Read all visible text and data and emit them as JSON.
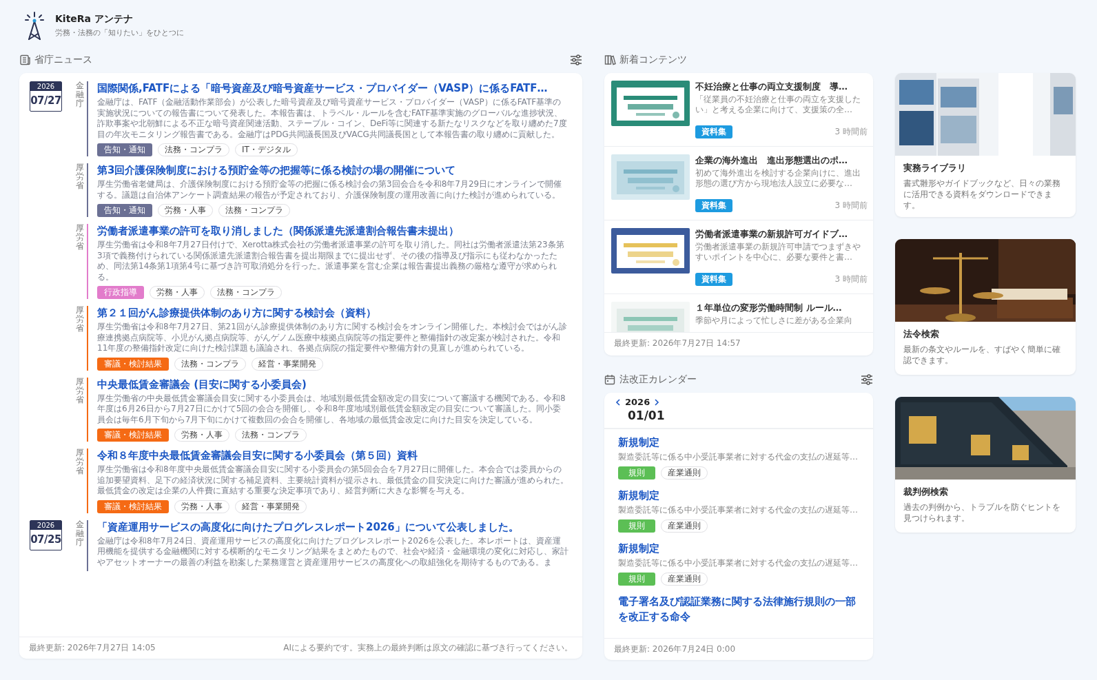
{
  "app": {
    "name": "KiteRa アンテナ",
    "tagline": "労務・法務の「知りたい」をひとつに"
  },
  "news": {
    "title": "省庁ニュース",
    "items": [
      {
        "date": {
          "year": "2026",
          "day": "07/27"
        },
        "ministry": "金融庁",
        "title": "国際関係,FATFによる「暗号資産及び暗号資産サービス・プロバイダー（VASP）に係るFATF…",
        "summary": "金融庁は、FATF（金融活動作業部会）が公表した暗号資産及び暗号資産サービス・プロバイダー（VASP）に係るFATF基準の実施状況についての報告書について発表した。本報告書は、トラベル・ルールを含むFATF基準実施のグローバルな進捗状況、詐欺事案や北朝鮮による不正な暗号資産関連活動、ステーブル・コイン、DeFi等に関連する新たなリスクなどを取り纏めた7度目の年次モニタリング報告書である。金融庁はPDG共同議長国及びVACG共同議長国として本報告書の取り纏めに貢献した。",
        "category": {
          "label": "告知・通知",
          "color": "#6b7094"
        },
        "tags": [
          "法務・コンプラ",
          "IT・デジタル"
        ]
      },
      {
        "ministry": "厚労省",
        "title": "第3回介護保険制度における預貯金等の把握等に係る検討の場の開催について",
        "summary": "厚生労働省老健局は、介護保険制度における預貯金等の把握に係る検討会の第3回会合を令和8年7月29日にオンラインで開催する。議題は自治体アンケート調査結果の報告が予定されており、介護保険制度の運用改善に向けた検討が進められている。",
        "category": {
          "label": "告知・通知",
          "color": "#6b7094"
        },
        "tags": [
          "労務・人事",
          "法務・コンプラ"
        ]
      },
      {
        "ministry": "厚労省",
        "title": "労働者派遣事業の許可を取り消しました（関係派遣先派遣割合報告書未提出）",
        "summary": "厚生労働省は令和8年7月27日付けで、Xerotta株式会社の労働者派遣事業の許可を取り消した。同社は労働者派遣法第23条第3項で義務付けられている関係派遣先派遣割合報告書を提出期限までに提出せず、その後の指導及び指示にも従わなかったため、同法第14条第1項第4号に基づき許可取消処分を行った。派遣事業を営む企業は報告書提出義務の厳格な遵守が求められる。",
        "category": {
          "label": "行政指導",
          "color": "#e27ccb"
        },
        "tags": [
          "労務・人事",
          "法務・コンプラ"
        ]
      },
      {
        "ministry": "厚労省",
        "title": "第２１回がん診療提供体制のあり方に関する検討会（資料）",
        "summary": "厚生労働省は令和8年7月27日、第21回がん診療提供体制のあり方に関する検討会をオンライン開催した。本検討会ではがん診療連携拠点病院等、小児がん拠点病院等、がんゲノム医療中核拠点病院等の指定要件と整備指針の改定案が検討された。令和11年度の整備指針改定に向けた検討課題も議論され、各拠点病院の指定要件や整備方針の見直しが進められている。",
        "category": {
          "label": "審議・検討結果",
          "color": "#f56a14"
        },
        "tags": [
          "法務・コンプラ",
          "経営・事業開発"
        ]
      },
      {
        "ministry": "厚労省",
        "title": "中央最低賃金審議会 (目安に関する小委員会)",
        "summary": "厚生労働省の中央最低賃金審議会目安に関する小委員会は、地域別最低賃金額改定の目安について審議する機関である。令和8年度は6月26日から7月27日にかけて5回の会合を開催し、令和8年度地域別最低賃金額改定の目安について審議した。同小委員会は毎年6月下旬から7月下旬にかけて複数回の会合を開催し、各地域の最低賃金改定に向けた目安を決定している。",
        "category": {
          "label": "審議・検討結果",
          "color": "#f56a14"
        },
        "tags": [
          "労務・人事",
          "法務・コンプラ"
        ]
      },
      {
        "ministry": "厚労省",
        "title": "令和８年度中央最低賃金審議会目安に関する小委員会（第５回）資料",
        "summary": "厚生労働省は令和8年度中央最低賃金審議会目安に関する小委員会の第5回会合を7月27日に開催した。本会合では委員からの追加要望資料、足下の経済状況に関する補足資料、主要統計資料が提示され、最低賃金の目安決定に向けた審議が進められた。最低賃金の改定は企業の人件費に直結する重要な決定事項であり、経営判断に大きな影響を与える。",
        "category": {
          "label": "審議・検討結果",
          "color": "#f56a14"
        },
        "tags": [
          "労務・人事",
          "経営・事業開発"
        ]
      },
      {
        "date": {
          "year": "2026",
          "day": "07/25"
        },
        "ministry": "金融庁",
        "title": "「資産運用サービスの高度化に向けたプログレスレポート2026」について公表しました。",
        "summary": "金融庁は令和8年7月24日、資産運用サービスの高度化に向けたプログレスレポート2026を公表した。本レポートは、資産運用機能を提供する金融機関に対する横断的なモニタリング結果をまとめたもので、社会や経済・金融環境の変化に対応し、家計やアセットオーナーの最善の利益を勘案した業務運営と資産運用サービスの高度化への取組強化を期待するものである。ま"
      }
    ],
    "updated": "最終更新: 2026年7月27日 14:05",
    "disclaimer": "AIによる要約です。実務上の最終判断は原文の確認に基づき行ってください。"
  },
  "new_contents": {
    "title": "新着コンテンツ",
    "items": [
      {
        "title": "不妊治療と仕事の両立支援制度　導…",
        "description": "「従業員の不妊治療と仕事の両立を支援したい」と考える企業に向けて、支援策の全…",
        "badge": "資料集",
        "time": "3 時間前"
      },
      {
        "title": "企業の海外進出　進出形態選出のポ…",
        "description": "初めて海外進出を検討する企業向けに、進出形態の選び方から現地法人設立に必要な…",
        "badge": "資料集",
        "time": "3 時間前"
      },
      {
        "title": "労働者派遣事業の新規許可ガイドブ…",
        "description": "労働者派遣事業の新規許可申請でつまずきやすいポイントを中心に、必要な要件と書…",
        "badge": "資料集",
        "time": "3 時間前"
      },
      {
        "title": "１年単位の変形労働時間制 ルール…",
        "description": "季節や月によって忙しさに差がある企業向"
      }
    ],
    "updated": "最終更新: 2026年7月27日 14:57"
  },
  "calendar": {
    "title": "法改正カレンダー",
    "year": "2026",
    "date": "01/01",
    "items": [
      {
        "title": "新規制定",
        "summary": "製造委託等に係る中小受託事業者に対する代金の支払の遅延等…",
        "category": {
          "label": "規則",
          "color": "#5cbf55"
        },
        "tags": [
          "産業通則"
        ]
      },
      {
        "title": "新規制定",
        "summary": "製造委託等に係る中小受託事業者に対する代金の支払の遅延等…",
        "category": {
          "label": "規則",
          "color": "#5cbf55"
        },
        "tags": [
          "産業通則"
        ]
      },
      {
        "title": "新規制定",
        "summary": "製造委託等に係る中小受託事業者に対する代金の支払の遅延等…",
        "category": {
          "label": "規則",
          "color": "#5cbf55"
        },
        "tags": [
          "産業通則"
        ]
      },
      {
        "title": "電子署名及び認証業務に関する法律施行規則の一部を改正する命令"
      }
    ],
    "updated": "最終更新: 2026年7月24日 0:00"
  },
  "links": [
    {
      "kind": "library",
      "title": "実務ライブラリ",
      "description": "書式雛形やガイドブックなど、日々の業務に活用できる資料をダウンロードできます。"
    },
    {
      "kind": "law",
      "title": "法令検索",
      "description": "最新の条文やルールを、すばやく簡単に確認できます。"
    },
    {
      "kind": "court",
      "title": "裁判例検索",
      "description": "過去の判例から、トラブルを防ぐヒントを見つけられます。"
    }
  ]
}
